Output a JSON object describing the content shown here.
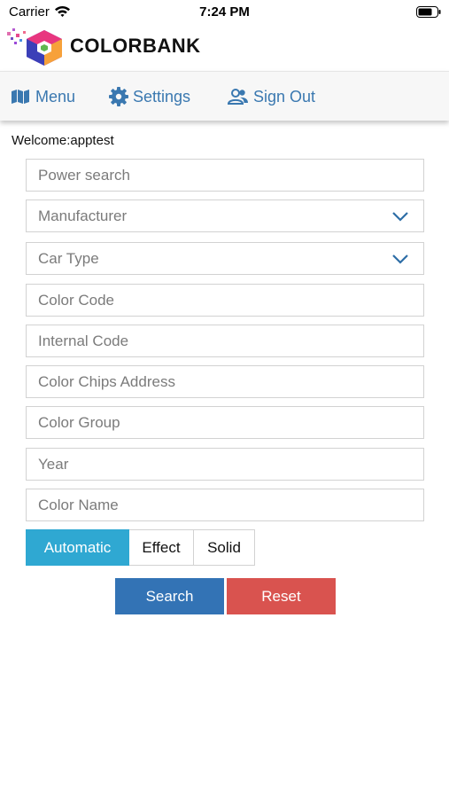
{
  "status_bar": {
    "carrier": "Carrier",
    "time": "7:24 PM"
  },
  "logo": {
    "text": "COLORBANK"
  },
  "nav": [
    {
      "label": "Menu",
      "icon": "map-icon"
    },
    {
      "label": "Settings",
      "icon": "gear-icon"
    },
    {
      "label": "Sign Out",
      "icon": "users-icon"
    }
  ],
  "welcome": "Welcome:apptest",
  "form": {
    "power_search": {
      "placeholder": "Power search",
      "value": ""
    },
    "manufacturer": {
      "value": "Manufacturer"
    },
    "car_type": {
      "value": "Car Type"
    },
    "color_code": {
      "placeholder": "Color Code",
      "value": ""
    },
    "internal_code": {
      "placeholder": "Internal Code",
      "value": ""
    },
    "color_chips_address": {
      "placeholder": "Color Chips Address",
      "value": ""
    },
    "color_group": {
      "placeholder": "Color Group",
      "value": ""
    },
    "year": {
      "placeholder": "Year",
      "value": ""
    },
    "color_name": {
      "placeholder": "Color Name",
      "value": ""
    }
  },
  "finish_options": [
    {
      "label": "Automatic",
      "selected": true
    },
    {
      "label": "Effect",
      "selected": false
    },
    {
      "label": "Solid",
      "selected": false
    }
  ],
  "buttons": {
    "search": "Search",
    "reset": "Reset"
  },
  "colors": {
    "nav_link": "#3a78b0",
    "segment_active": "#2fa8d2",
    "search_button": "#3373b5",
    "reset_button": "#d9534f",
    "chevron": "#2d6da6"
  }
}
